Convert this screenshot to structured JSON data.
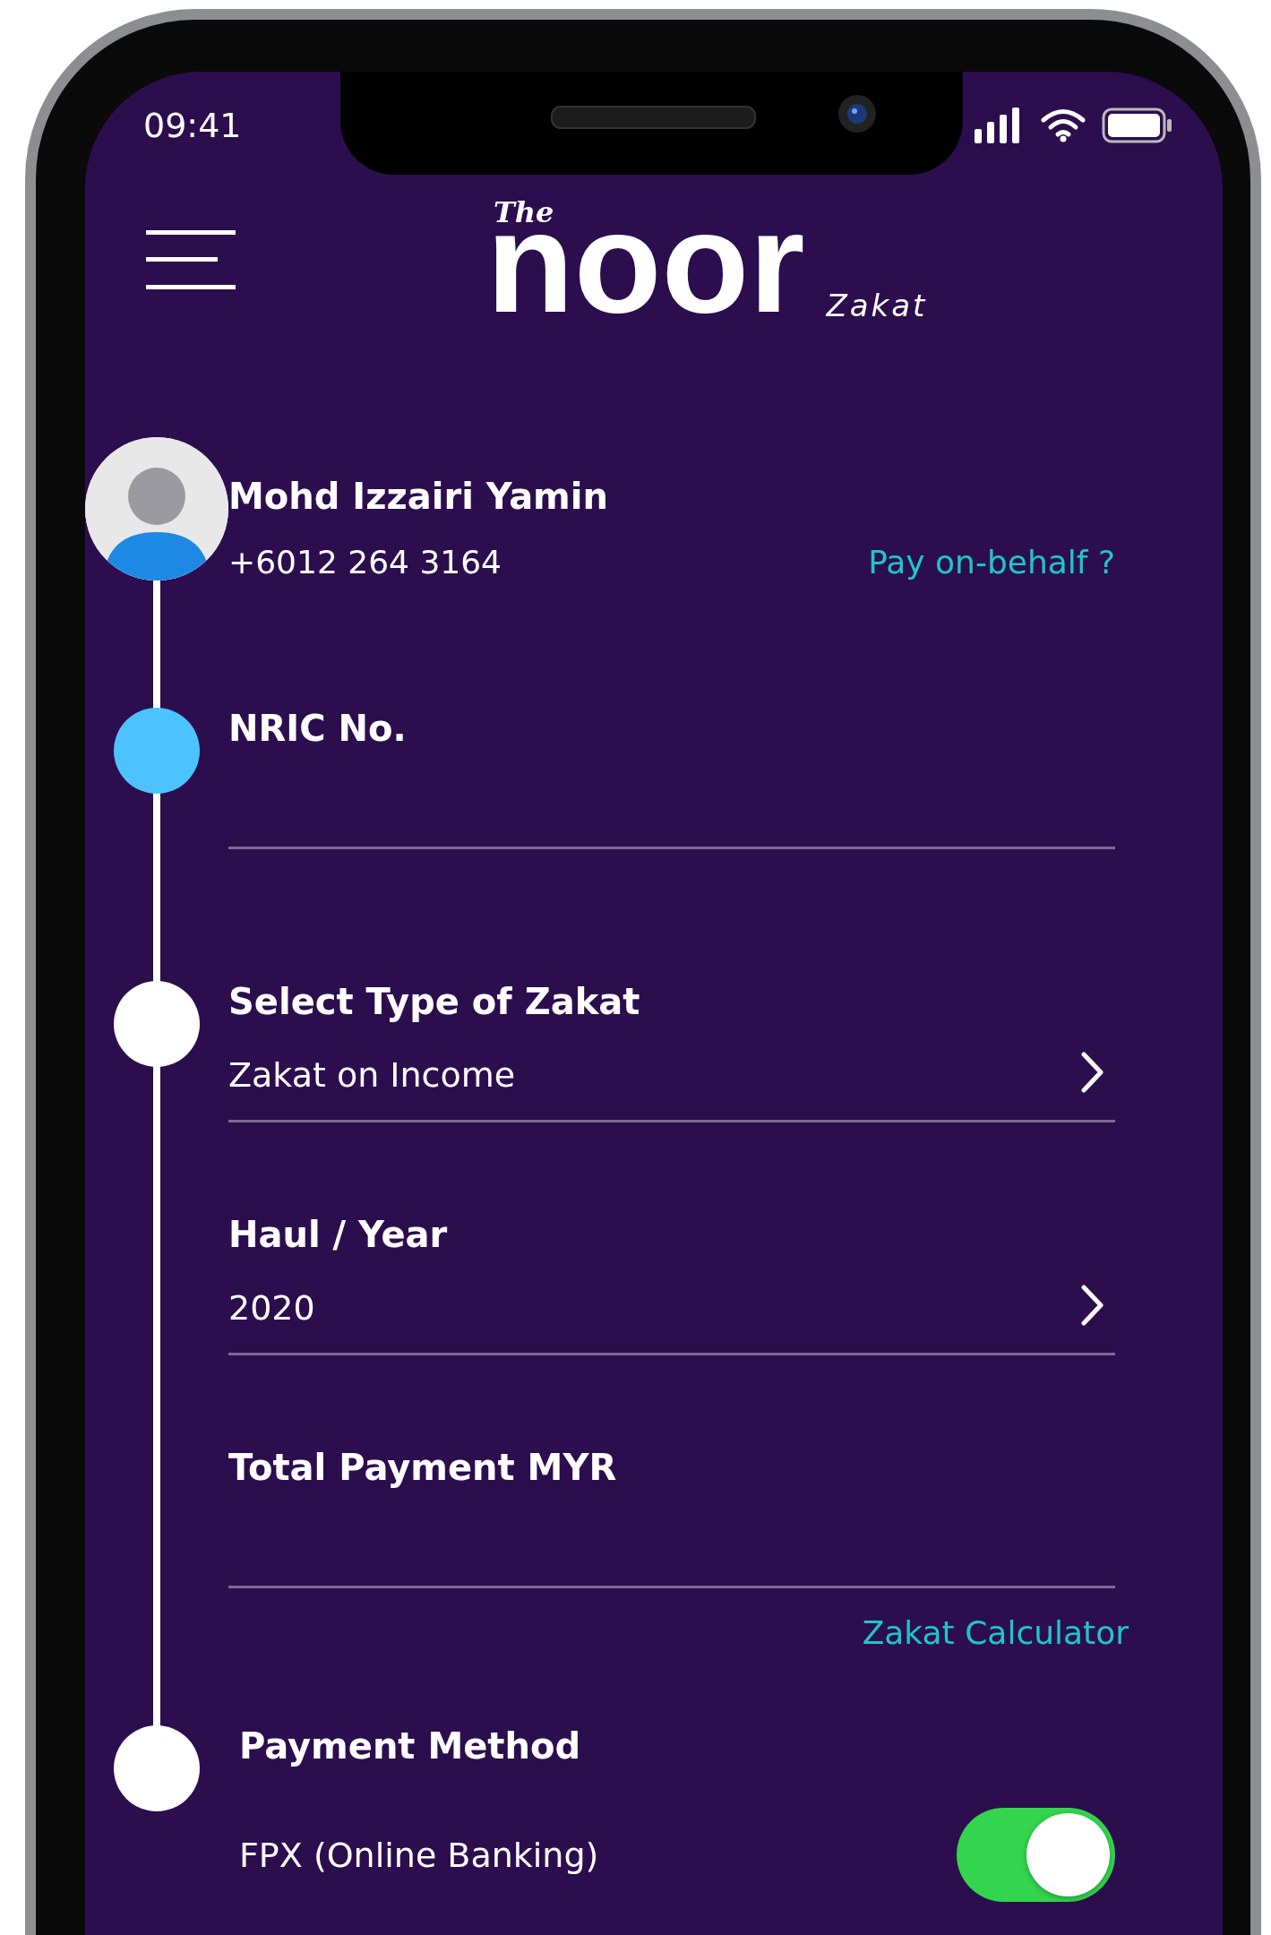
{
  "status_bar": {
    "time": "09:41"
  },
  "header": {
    "logo": {
      "prefix": "The",
      "name": "noor",
      "suffix": "Zakat"
    }
  },
  "profile": {
    "name": "Mohd Izzairi Yamin",
    "phone": "+6012 264 3164",
    "link": "Pay on-behalf ?"
  },
  "fields": [
    {
      "kind": "textstep",
      "active": true,
      "label": "NRIC No."
    },
    {
      "kind": "selectstep",
      "active": false,
      "label": "Select Type of Zakat",
      "value": "Zakat on Income"
    },
    {
      "kind": "select",
      "active": false,
      "label": "Haul / Year",
      "value": "2020"
    },
    {
      "kind": "text",
      "active": false,
      "label": "Total Payment MYR",
      "link": "Zakat Calculator"
    }
  ],
  "payment": {
    "label": "Payment Method",
    "active": false,
    "options": [
      {
        "label": "FPX (Online Banking)",
        "on": true
      }
    ]
  }
}
